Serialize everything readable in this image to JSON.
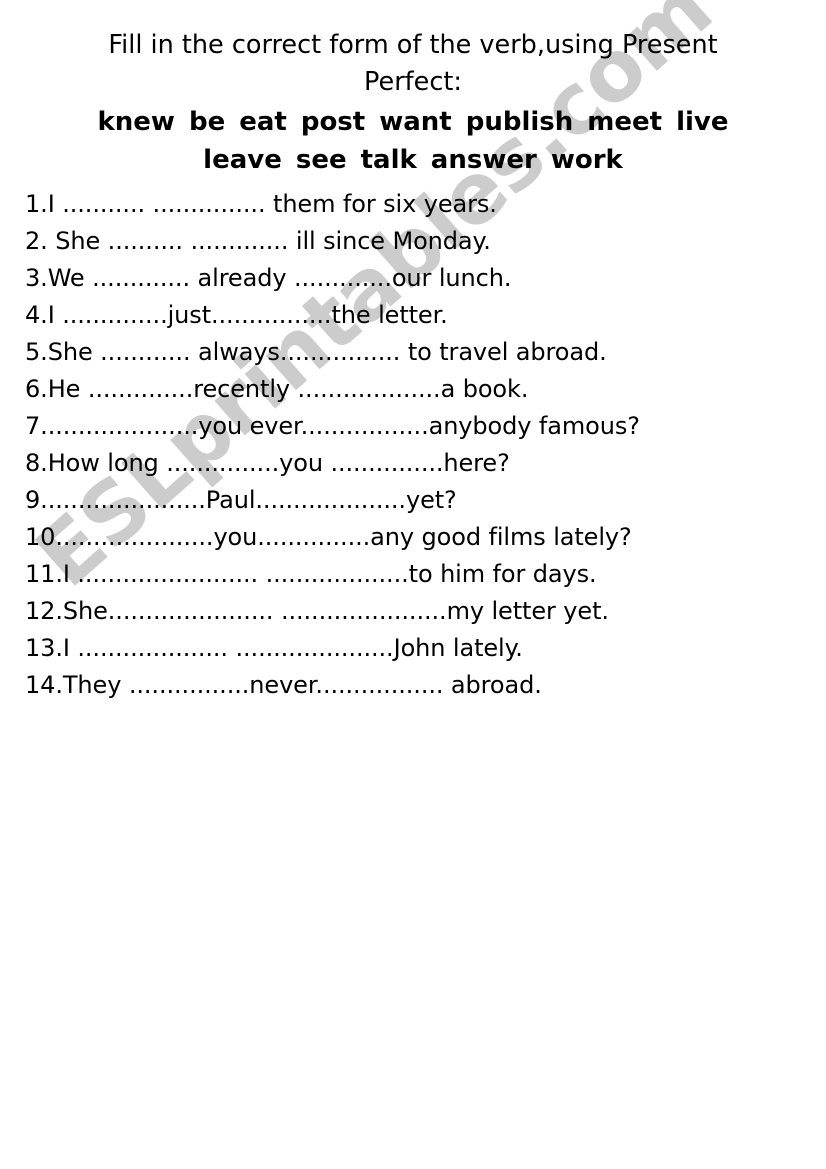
{
  "worksheet": {
    "title_lines": [
      "Fill in the correct form of the verb,using Present",
      "Perfect:"
    ],
    "word_bank": {
      "line1": [
        "knew",
        "be",
        "eat",
        "post",
        "want",
        "publish",
        "meet",
        "live"
      ],
      "line2": [
        "leave",
        "see",
        "talk",
        "answer",
        "work"
      ]
    },
    "exercises": [
      "1.I  ........... ............... them  for six years.",
      "2. She .......... ............. ill since Monday.",
      "3.We ............. already  .............our lunch.",
      "4.I ..............just................the letter.",
      "5.She ............ always................ to travel abroad.",
      "6.He ..............recently ...................a book.",
      "7.....................you ever.................anybody famous?",
      "8.How long ...............you ...............here?",
      "9......................Paul....................yet?",
      "10.....................you...............any good films lately?",
      "11.I ........................ ...................to him for days.",
      "12.She...................... ......................my letter yet.",
      "13.I .................... .....................John lately.",
      "14.They ................never................. abroad."
    ],
    "watermark": "ESLprintables.com",
    "colors": {
      "text": "#000000",
      "background": "#ffffff",
      "watermark": "#cccccc"
    }
  }
}
